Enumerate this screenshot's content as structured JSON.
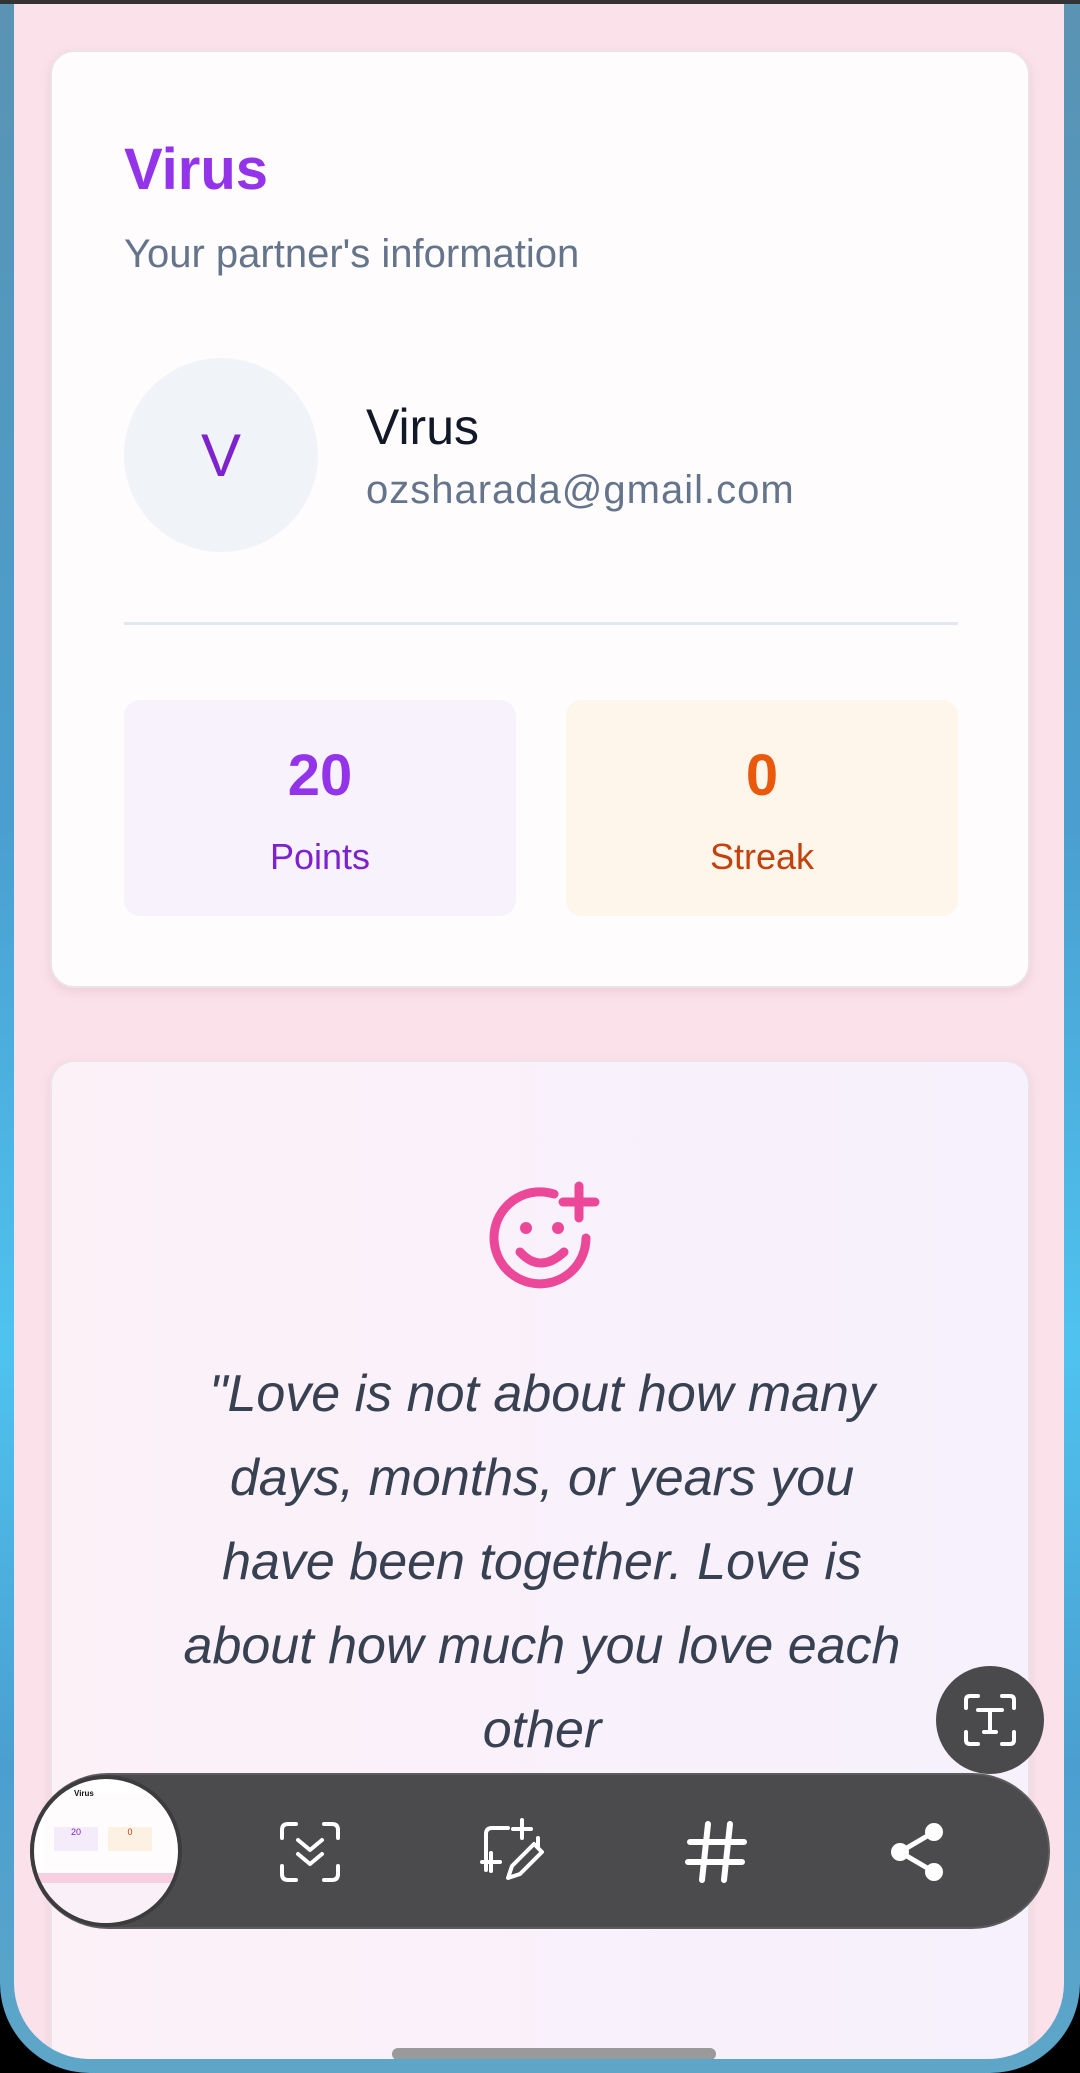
{
  "partner_card": {
    "title": "Virus",
    "subtitle": "Your partner's information",
    "avatar_initial": "V",
    "name": "Virus",
    "email": "ozsharada@gmail.com",
    "stats": {
      "points_value": "20",
      "points_label": "Points",
      "streak_value": "0",
      "streak_label": "Streak"
    }
  },
  "quote_card": {
    "icon": "smile-plus-icon",
    "quote": "\"Love is not about how many days, months, or years you have been together. Love is about how much you love each other"
  },
  "screenshot_toolbar": {
    "thumbnail": {
      "title": "Virus",
      "points": "20",
      "streak": "0"
    },
    "tools": [
      "scroll-capture-icon",
      "draw-icon",
      "hashtag-icon",
      "share-icon"
    ],
    "text_extract": "text-recognition-icon"
  },
  "colors": {
    "accent_purple": "#9333ea",
    "accent_orange": "#ea580c",
    "accent_pink": "#ec4899",
    "background": "#fbe1ea"
  }
}
